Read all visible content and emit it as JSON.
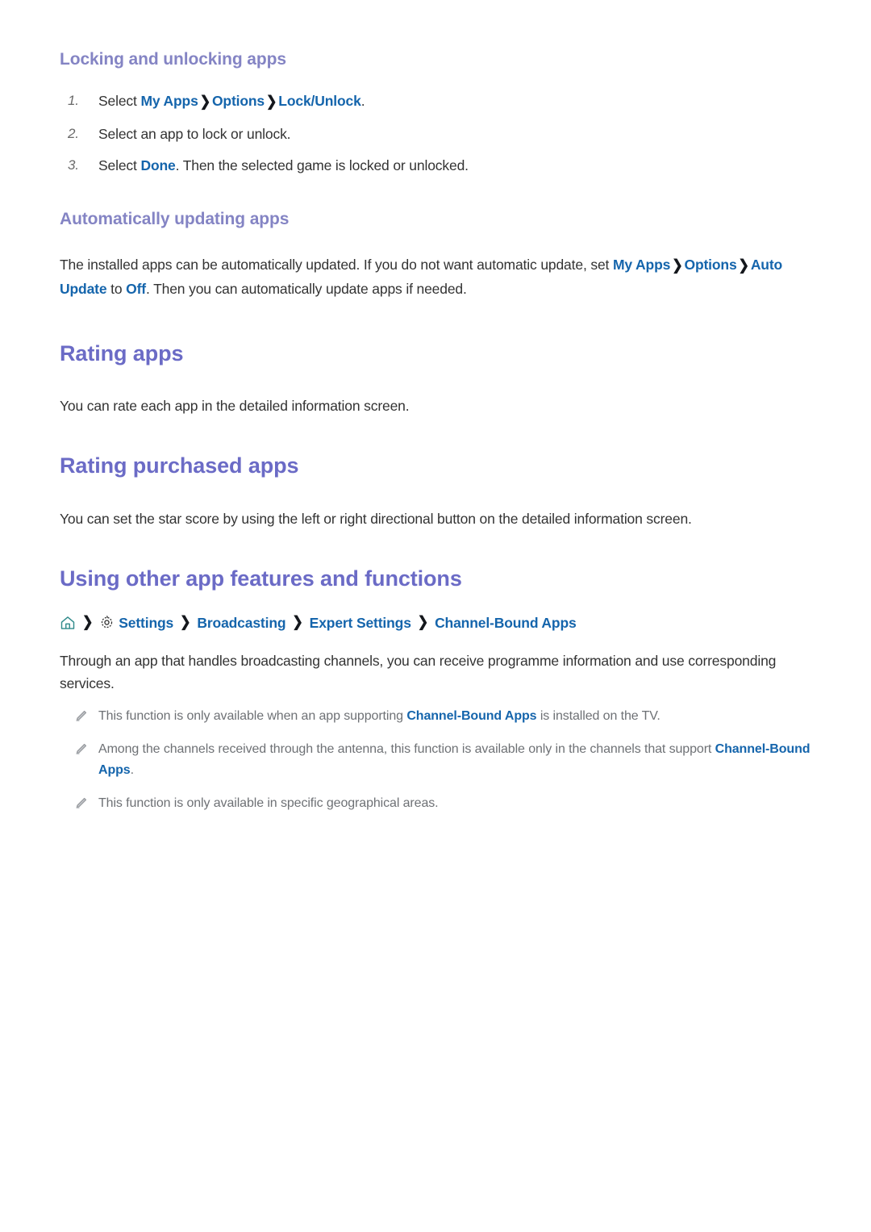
{
  "sections": {
    "locking": {
      "heading": "Locking and unlocking apps",
      "steps": [
        {
          "num": "1.",
          "pre": "Select ",
          "links": [
            "My Apps",
            "Options",
            "Lock/Unlock"
          ],
          "post": "."
        },
        {
          "num": "2.",
          "text": "Select an app to lock or unlock."
        },
        {
          "num": "3.",
          "pre": "Select ",
          "link": "Done",
          "post": ". Then the selected game is locked or unlocked."
        }
      ]
    },
    "auto_update": {
      "heading": "Automatically updating apps",
      "paragraph": {
        "part1": "The installed apps can be automatically updated. If you do not want automatic update, set ",
        "link1": "My Apps",
        "link2": "Options",
        "link3": "Auto Update",
        "mid": " to ",
        "link4": "Off",
        "part2": ". Then you can automatically update apps if needed."
      }
    },
    "rating_apps": {
      "heading": "Rating apps",
      "paragraph": "You can rate each app in the detailed information screen."
    },
    "rating_purchased": {
      "heading": "Rating purchased apps",
      "paragraph": "You can set the star score by using the left or right directional button on the detailed information screen."
    },
    "other_features": {
      "heading": "Using other app features and functions",
      "breadcrumb": {
        "home_icon": "home-icon",
        "gear_icon": "gear-icon",
        "items": [
          "Settings",
          "Broadcasting",
          "Expert Settings",
          "Channel-Bound Apps"
        ],
        "separator": "❯"
      },
      "paragraph": "Through an app that handles broadcasting channels, you can receive programme information and use corresponding services.",
      "notes": [
        {
          "icon": "pencil-icon",
          "pre": "This function is only available when an app supporting ",
          "link": "Channel-Bound Apps",
          "post": " is installed on the TV."
        },
        {
          "icon": "pencil-icon",
          "pre": "Among the channels received through the antenna, this function is available only in the channels that support ",
          "link": "Channel-Bound Apps",
          "post": "."
        },
        {
          "icon": "pencil-icon",
          "pre": "This function is only available in specific geographical areas.",
          "link": "",
          "post": ""
        }
      ]
    }
  },
  "colors": {
    "h1": "#6b6bc6",
    "h2": "#8484c4",
    "link": "#1565ac",
    "body": "#333333",
    "note": "#6e7175",
    "home_icon": "#2f8a8a",
    "gear_icon": "#2b2b2b",
    "pencil_icon": "#9a9da1"
  }
}
